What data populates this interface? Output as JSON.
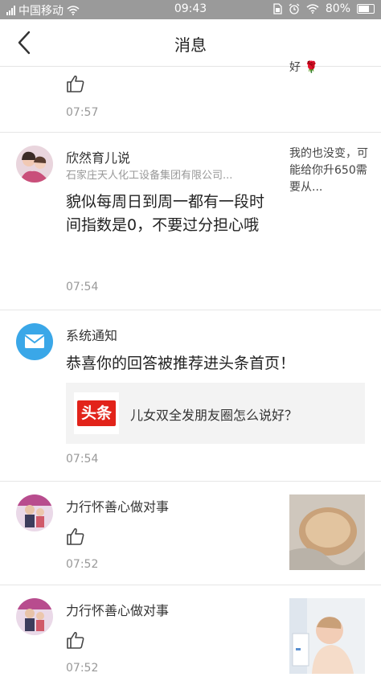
{
  "status_bar": {
    "carrier": "中国移动",
    "time": "09:43",
    "battery": "80%"
  },
  "header": {
    "title": "消息"
  },
  "messages": [
    {
      "time": "07:57",
      "right_text": "好 🌹"
    },
    {
      "name": "欣然育儿说",
      "subtitle": "石家庄天人化工设备集团有限公司...",
      "content": "貌似每周日到周一都有一段时间指数是0，不要过分担心哦",
      "time": "07:54",
      "right_text": "我的也没变，可能给你升650需要从..."
    },
    {
      "name": "系统通知",
      "content": "恭喜你的回答被推荐进头条首页！",
      "card_logo": "头条",
      "card_title": "儿女双全发朋友圈怎么说好？",
      "time": "07:54"
    },
    {
      "name": "力行怀善心做对事",
      "time": "07:52"
    },
    {
      "name": "力行怀善心做对事",
      "time": "07:52"
    }
  ]
}
